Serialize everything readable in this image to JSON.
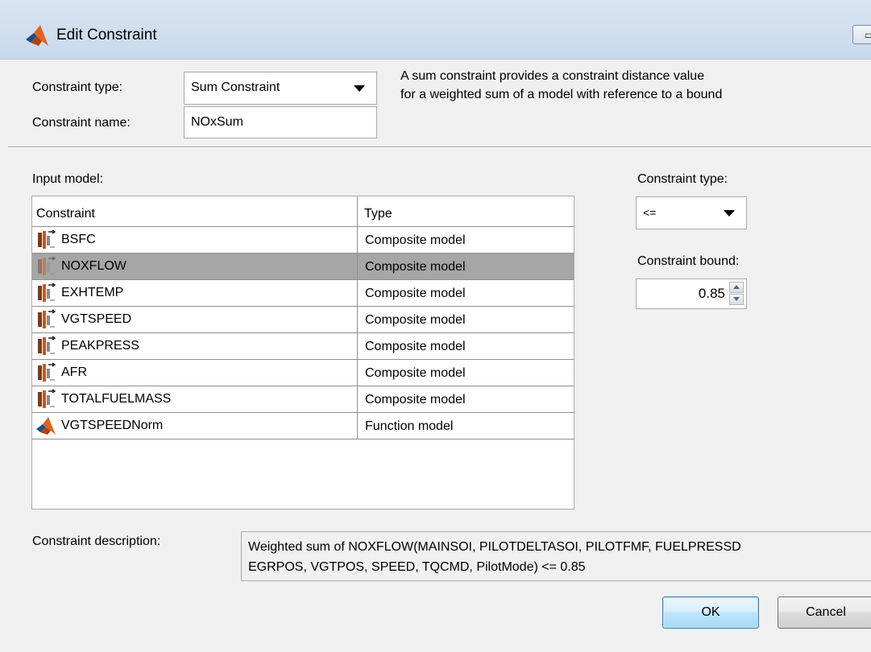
{
  "window": {
    "title": "Edit Constraint"
  },
  "header": {
    "constraint_type_label": "Constraint type:",
    "constraint_type_value": "Sum Constraint",
    "constraint_name_label": "Constraint name:",
    "constraint_name_value": "NOxSum",
    "description_line1": "A sum constraint provides a constraint distance value",
    "description_line2": "for a weighted sum of a model with reference to a bound"
  },
  "input_model": {
    "label": "Input model:",
    "columns": [
      "Constraint",
      "Type"
    ],
    "rows": [
      {
        "name": "BSFC",
        "type": "Composite model",
        "icon": "composite-model-icon",
        "selected": false
      },
      {
        "name": "NOXFLOW",
        "type": "Composite model",
        "icon": "composite-model-icon",
        "selected": true
      },
      {
        "name": "EXHTEMP",
        "type": "Composite model",
        "icon": "composite-model-icon",
        "selected": false
      },
      {
        "name": "VGTSPEED",
        "type": "Composite model",
        "icon": "composite-model-icon",
        "selected": false
      },
      {
        "name": "PEAKPRESS",
        "type": "Composite model",
        "icon": "composite-model-icon",
        "selected": false
      },
      {
        "name": "AFR",
        "type": "Composite model",
        "icon": "composite-model-icon",
        "selected": false
      },
      {
        "name": "TOTALFUELMASS",
        "type": "Composite model",
        "icon": "composite-model-icon",
        "selected": false
      },
      {
        "name": "VGTSPEEDNorm",
        "type": "Function model",
        "icon": "matlab-function-icon",
        "selected": false
      }
    ]
  },
  "right_panel": {
    "constraint_type_label": "Constraint type:",
    "constraint_type_value": "<=",
    "constraint_bound_label": "Constraint bound:",
    "constraint_bound_value": "0.85"
  },
  "description": {
    "label": "Constraint description:",
    "line1": "Weighted sum of NOXFLOW(MAINSOI, PILOTDELTASOI, PILOTFMF, FUELPRESSD",
    "line2": "EGRPOS, VGTPOS, SPEED, TQCMD, PilotMode) <= 0.85"
  },
  "buttons": {
    "ok": "OK",
    "cancel": "Cancel"
  },
  "colors": {
    "selected_row": "#a6a6a6",
    "window_bg": "#f0f0f0",
    "titlebar": "#c9d9ec"
  }
}
